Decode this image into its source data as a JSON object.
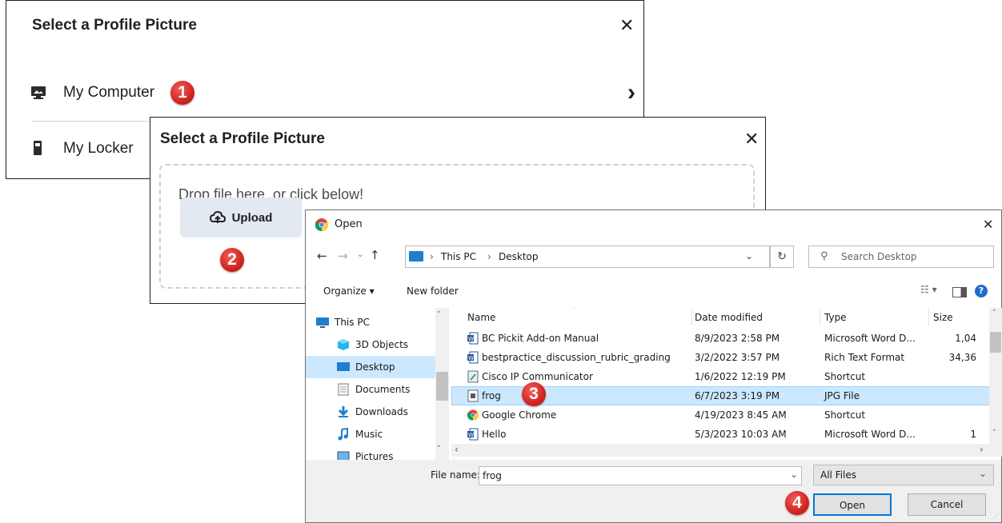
{
  "dialog1": {
    "title": "Select a Profile Picture",
    "close_glyph": "✕",
    "items": [
      {
        "label": "My Computer",
        "icon": "computer-icon",
        "arrow": "›"
      },
      {
        "label": "My Locker",
        "icon": "locker-icon"
      }
    ]
  },
  "dialog2": {
    "title": "Select a Profile Picture",
    "close_glyph": "✕",
    "drop_text": "Drop file here, or click below!",
    "upload_label": "Upload"
  },
  "badges": [
    "1",
    "2",
    "3",
    "4"
  ],
  "open_dialog": {
    "title": "Open",
    "close_glyph": "✕",
    "breadcrumb": [
      "This PC",
      "Desktop"
    ],
    "search_placeholder": "Search Desktop",
    "toolbar": {
      "organize": "Organize ▾",
      "new_folder": "New folder"
    },
    "tree": [
      {
        "label": "This PC",
        "icon": "pc-icon"
      },
      {
        "label": "3D Objects",
        "icon": "cube-icon"
      },
      {
        "label": "Desktop",
        "icon": "desktop-icon",
        "selected": true
      },
      {
        "label": "Documents",
        "icon": "documents-icon"
      },
      {
        "label": "Downloads",
        "icon": "download-icon"
      },
      {
        "label": "Music",
        "icon": "music-icon"
      },
      {
        "label": "Pictures",
        "icon": "pictures-icon"
      }
    ],
    "columns": [
      "Name",
      "Date modified",
      "Type",
      "Size"
    ],
    "files": [
      {
        "name": "BC Pickit Add-on Manual",
        "date": "8/9/2023 2:58 PM",
        "type": "Microsoft Word D...",
        "size": "1,04",
        "icon": "word-icon"
      },
      {
        "name": "bestpractice_discussion_rubric_grading",
        "date": "3/2/2022 3:57 PM",
        "type": "Rich Text Format",
        "size": "34,36",
        "icon": "rtf-icon"
      },
      {
        "name": "Cisco IP Communicator",
        "date": "1/6/2022 12:19 PM",
        "type": "Shortcut",
        "size": "",
        "icon": "shortcut-icon"
      },
      {
        "name": "frog",
        "date": "6/7/2023 3:19 PM",
        "type": "JPG File",
        "size": "",
        "icon": "image-file-icon",
        "selected": true
      },
      {
        "name": "Google Chrome",
        "date": "4/19/2023 8:45 AM",
        "type": "Shortcut",
        "size": "",
        "icon": "chrome-icon"
      },
      {
        "name": "Hello",
        "date": "5/3/2023 10:03 AM",
        "type": "Microsoft Word D...",
        "size": "1",
        "icon": "word-icon"
      }
    ],
    "file_name_label": "File name:",
    "file_name_value": "frog",
    "filter_value": "All Files",
    "open_label": "Open",
    "cancel_label": "Cancel"
  },
  "colors": {
    "badge_red": "#d3231e",
    "selection_blue": "#cce8ff",
    "upload_bg": "#e3e9f1"
  }
}
